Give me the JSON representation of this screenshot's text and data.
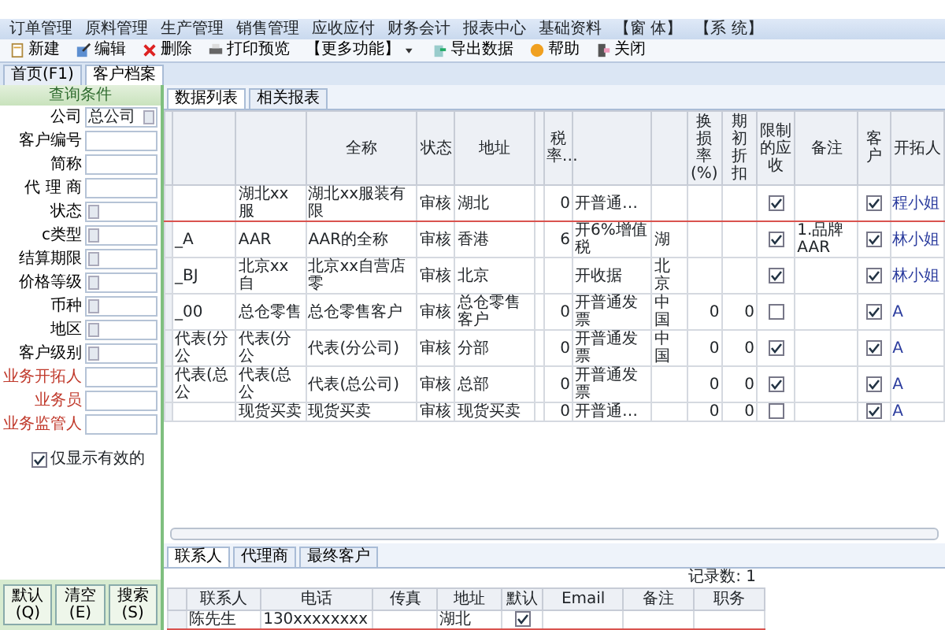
{
  "menu": [
    "订单管理",
    "原料管理",
    "生产管理",
    "销售管理",
    "应收应付",
    "财务会计",
    "报表中心",
    "基础资料",
    "【窗 体】",
    "【系 统】"
  ],
  "toolbar": [
    {
      "label": "新建",
      "kind": "button"
    },
    {
      "label": "编辑",
      "kind": "button"
    },
    {
      "label": "删除",
      "kind": "button"
    },
    {
      "label": "打印预览",
      "kind": "button"
    },
    {
      "label": "【更多功能】",
      "kind": "dropdown"
    },
    {
      "label": "导出数据",
      "kind": "button"
    },
    {
      "label": "帮助",
      "kind": "button"
    },
    {
      "label": "关闭",
      "kind": "button"
    }
  ],
  "page_tabs": [
    {
      "label": "首页(F1)",
      "selected": false
    },
    {
      "label": "客户档案",
      "selected": true
    }
  ],
  "query": {
    "title": "查询条件",
    "fields": [
      {
        "label": "公司",
        "kind": "select",
        "value": "总公司",
        "color": "#000000"
      },
      {
        "label": "客户编号",
        "kind": "text",
        "color": "#000000"
      },
      {
        "label": "简称",
        "kind": "text",
        "color": "#000000"
      },
      {
        "label": "代 理 商",
        "kind": "text",
        "color": "#000000"
      },
      {
        "label": "状态",
        "kind": "select",
        "color": "#000000"
      },
      {
        "label": "c类型",
        "kind": "select",
        "color": "#000000"
      },
      {
        "label": "结算期限",
        "kind": "select",
        "color": "#000000"
      },
      {
        "label": "价格等级",
        "kind": "select",
        "color": "#000000"
      },
      {
        "label": "币种",
        "kind": "select",
        "color": "#000000"
      },
      {
        "label": "地区",
        "kind": "select",
        "color": "#000000"
      },
      {
        "label": "客户级别",
        "kind": "select",
        "color": "#000000"
      },
      {
        "label": "业务开拓人",
        "kind": "text",
        "color": "#c0392b"
      },
      {
        "label": "业务员",
        "kind": "text",
        "color": "#c0392b"
      },
      {
        "label": "业务监管人",
        "kind": "text",
        "color": "#c0392b"
      }
    ],
    "only_valid": {
      "label": "仅显示有效的",
      "checked": true
    },
    "buttons": [
      "默认(Q)",
      "清空(E)",
      "搜索(S)"
    ]
  },
  "data_tabs": [
    {
      "label": "数据列表",
      "selected": true
    },
    {
      "label": "相关报表",
      "selected": false
    }
  ],
  "table": {
    "columns": [
      "",
      "",
      "全称",
      "状态",
      "地址",
      "",
      "税率…",
      "",
      "",
      "换损率(%)",
      "期初折扣",
      "限制的应收",
      "备注",
      "客户",
      "开拓人"
    ],
    "rows": [
      {
        "selected": true,
        "cells": [
          "",
          "湖北xx服",
          "湖北xx服装有限",
          "审核",
          "湖北",
          "",
          "0",
          "开普通…",
          "",
          "",
          "",
          true,
          "",
          true,
          "程小姐"
        ]
      },
      {
        "selected": false,
        "cells": [
          "_A",
          "AAR",
          "AAR的全称",
          "审核",
          "香港",
          "",
          "6",
          "开6%增值税",
          "湖",
          "",
          "",
          true,
          "1.品牌 AAR",
          true,
          "林小姐"
        ]
      },
      {
        "selected": false,
        "cells": [
          "_BJ",
          "北京xx自",
          "北京xx自营店零",
          "审核",
          "北京",
          "",
          "",
          "开收据",
          "北京",
          "",
          "",
          true,
          "",
          true,
          "林小姐"
        ]
      },
      {
        "selected": false,
        "cells": [
          "_00",
          "总仓零售",
          "总仓零售客户",
          "审核",
          "总仓零售客户",
          "",
          "0",
          "开普通发票",
          "中国",
          "0",
          "0",
          false,
          "",
          true,
          "A"
        ]
      },
      {
        "selected": false,
        "cells": [
          "代表(分公",
          "代表(分公",
          "代表(分公司)",
          "审核",
          "分部",
          "",
          "0",
          "开普通发票",
          "中国",
          "0",
          "0",
          true,
          "",
          true,
          "A"
        ]
      },
      {
        "selected": false,
        "cells": [
          "代表(总公",
          "代表(总公",
          "代表(总公司)",
          "审核",
          "总部",
          "",
          "0",
          "开普通发票",
          "",
          "0",
          "0",
          true,
          "",
          true,
          "A"
        ]
      },
      {
        "selected": false,
        "cells": [
          "",
          "现货买卖",
          "现货买卖",
          "审核",
          "现货买卖",
          "",
          "0",
          "开普通…",
          "",
          "0",
          "0",
          false,
          "",
          true,
          "A"
        ]
      }
    ]
  },
  "detail_tabs": [
    {
      "label": "联系人",
      "selected": true
    },
    {
      "label": "代理商",
      "selected": false
    },
    {
      "label": "最终客户",
      "selected": false
    }
  ],
  "record_count": "记录数: 1",
  "contacts": {
    "columns": [
      "联系人",
      "电话",
      "传真",
      "地址",
      "默认",
      "Email",
      "备注",
      "职务"
    ],
    "rows": [
      {
        "selected": true,
        "cells": [
          "陈先生",
          "130xxxxxxxx",
          "",
          "湖北",
          true,
          "",
          "",
          ""
        ]
      }
    ]
  }
}
